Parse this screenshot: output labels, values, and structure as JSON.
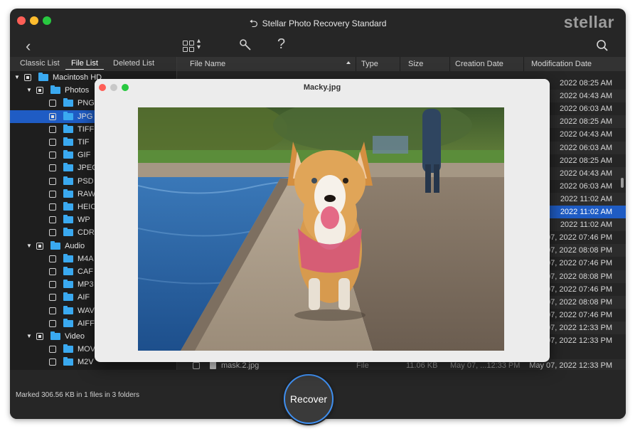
{
  "window": {
    "title": "Stellar Photo Recovery Standard",
    "brand": "stellar",
    "colors": {
      "background": "#262626",
      "selection": "#1f5cc4",
      "folder": "#3aa9f0",
      "close": "#fe5f57",
      "minimize": "#febc2e",
      "maximize": "#28c840"
    }
  },
  "toolbar": {
    "back_icon": "chevron-left-icon",
    "view_icon": "grid-view-icon",
    "tools_icon": "wrench-icon",
    "help_label": "?",
    "search_icon": "search-icon"
  },
  "tabs": [
    "Classic List",
    "File List",
    "Deleted List"
  ],
  "active_tab": "File List",
  "tree": [
    {
      "label": "Macintosh HD",
      "level": 0,
      "expanded": true
    },
    {
      "label": "Photos",
      "level": 1,
      "expanded": true
    },
    {
      "label": "PNG",
      "level": 2
    },
    {
      "label": "JPG",
      "level": 2,
      "selected": true
    },
    {
      "label": "TIFF",
      "level": 2
    },
    {
      "label": "TIF",
      "level": 2
    },
    {
      "label": "GIF",
      "level": 2
    },
    {
      "label": "JPEG",
      "level": 2
    },
    {
      "label": "PSD",
      "level": 2
    },
    {
      "label": "RAW",
      "level": 2
    },
    {
      "label": "HEIC",
      "level": 2
    },
    {
      "label": "WP",
      "level": 2
    },
    {
      "label": "CDR",
      "level": 2
    },
    {
      "label": "Audio",
      "level": 1,
      "expanded": true
    },
    {
      "label": "M4A",
      "level": 2
    },
    {
      "label": "CAF",
      "level": 2
    },
    {
      "label": "MP3",
      "level": 2
    },
    {
      "label": "AIF",
      "level": 2
    },
    {
      "label": "WAV",
      "level": 2
    },
    {
      "label": "AIFF",
      "level": 2
    },
    {
      "label": "Video",
      "level": 1,
      "expanded": true
    },
    {
      "label": "MOV",
      "level": 2
    },
    {
      "label": "M2V",
      "level": 2
    }
  ],
  "columns": [
    "File Name",
    "Type",
    "Size",
    "Creation Date",
    "Modification Date"
  ],
  "modification_dates": [
    "2022 08:25 AM",
    "2022 04:43 AM",
    "2022 06:03 AM",
    "2022 08:25 AM",
    "2022 04:43 AM",
    "2022 06:03 AM",
    "2022 08:25 AM",
    "2022 04:43 AM",
    "2022 06:03 AM",
    "2022 11:02 AM",
    "2022 11:02 AM",
    "2022 11:02 AM",
    "07, 2022 07:46 PM",
    "07, 2022 08:08 PM",
    "07, 2022 07:46 PM",
    "07, 2022 08:08 PM",
    "07, 2022 07:46 PM",
    "07, 2022 08:08 PM",
    "07, 2022 07:46 PM",
    "07, 2022 12:33 PM",
    "07, 2022 12:33 PM"
  ],
  "selected_row_index": 10,
  "last_row": {
    "name": "mask.2.jpg",
    "type": "File",
    "size": "11.06 KB",
    "created": "May 07, ...12:33 PM",
    "modified": "May 07, 2022 12:33 PM"
  },
  "status": "Marked 306.56 KB in 1 files in 3 folders",
  "recover_label": "Recover",
  "preview": {
    "title": "Macky.jpg"
  }
}
